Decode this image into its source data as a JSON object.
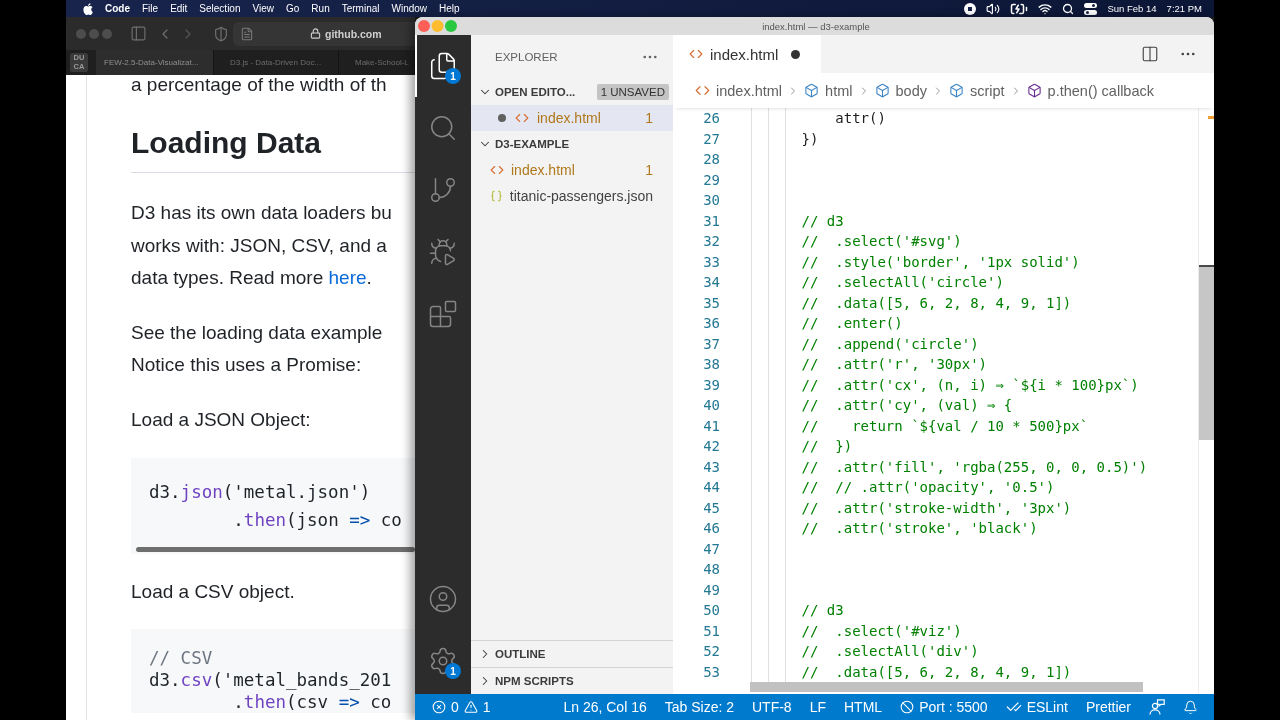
{
  "menu_bar": {
    "app_name": "Code",
    "menus": [
      "File",
      "Edit",
      "Selection",
      "View",
      "Go",
      "Run",
      "Terminal",
      "Window",
      "Help"
    ],
    "date": "Sun Feb 14",
    "time": "7:21 PM"
  },
  "browser": {
    "address": "github.com",
    "pinned_tab": "DU CA",
    "tabs": [
      {
        "label": "FEW-2.5-Data-Visualizat...",
        "selected": true
      },
      {
        "label": "D3.js - Data-Driven Doc...",
        "selected": false
      },
      {
        "label": "Make-School-L",
        "selected": false
      }
    ],
    "page": {
      "cut_line": "a percentage of the width of th",
      "heading": "Loading Data",
      "blocks": [
        {
          "kind": "paragraph",
          "lines": [
            [
              {
                "kind": "text",
                "text": "D3 has its own data loaders bu"
              }
            ],
            [
              {
                "kind": "text",
                "text": "works with: JSON, CSV, and a"
              }
            ],
            [
              {
                "kind": "text",
                "text": "data types. Read more "
              },
              {
                "kind": "link",
                "text": "here"
              },
              {
                "kind": "text",
                "text": "."
              }
            ]
          ]
        },
        {
          "kind": "paragraph",
          "lines": [
            [
              {
                "kind": "text",
                "text": "See the loading data example"
              }
            ],
            [
              {
                "kind": "text",
                "text": "Notice this uses a Promise:"
              }
            ]
          ]
        },
        {
          "kind": "paragraph",
          "lines": [
            [
              {
                "kind": "text",
                "text": "Load a JSON Object:"
              }
            ]
          ]
        },
        {
          "kind": "code",
          "scrollbar": true,
          "lines": [
            [
              {
                "kind": "plain",
                "text": "d3."
              },
              {
                "kind": "method",
                "text": "json"
              },
              {
                "kind": "plain",
                "text": "('metal.json')"
              }
            ],
            [
              {
                "kind": "plain",
                "text": "        ."
              },
              {
                "kind": "method",
                "text": "then"
              },
              {
                "kind": "plain",
                "text": "(json "
              },
              {
                "kind": "operator",
                "text": "=>"
              },
              {
                "kind": "plain",
                "text": " co"
              }
            ]
          ]
        },
        {
          "kind": "paragraph",
          "lines": [
            [
              {
                "kind": "text",
                "text": "Load a CSV object."
              }
            ]
          ]
        },
        {
          "kind": "code",
          "lines": [
            [
              {
                "kind": "comment",
                "text": "// CSV"
              }
            ],
            [
              {
                "kind": "plain",
                "text": "d3."
              },
              {
                "kind": "method",
                "text": "csv"
              },
              {
                "kind": "plain",
                "text": "('metal_bands_201"
              }
            ],
            [
              {
                "kind": "plain",
                "text": "        ."
              },
              {
                "kind": "method",
                "text": "then"
              },
              {
                "kind": "plain",
                "text": "(csv "
              },
              {
                "kind": "operator",
                "text": "=>"
              },
              {
                "kind": "plain",
                "text": " co"
              }
            ]
          ]
        }
      ]
    }
  },
  "editor_window": {
    "title": "index.html — d3-example",
    "activity_bar": [
      {
        "kind": "explorer",
        "selected": true,
        "badge": "1"
      },
      {
        "kind": "search",
        "selected": false
      },
      {
        "kind": "source_control",
        "selected": false
      },
      {
        "kind": "run_debug",
        "selected": false
      },
      {
        "kind": "extensions",
        "selected": false
      }
    ],
    "activity_bar_bottom": [
      {
        "kind": "accounts"
      },
      {
        "kind": "settings",
        "badge": "1"
      }
    ],
    "sidebar": {
      "title": "EXPLORER",
      "sections": [
        {
          "title": "OPEN EDITO...",
          "expanded": true,
          "badge": "1 UNSAVED",
          "items": [
            {
              "kind": "html",
              "name": "index.html",
              "modified": true,
              "problems": "1",
              "selected": true
            }
          ]
        },
        {
          "title": "D3-EXAMPLE",
          "expanded": true,
          "items": [
            {
              "kind": "html",
              "name": "index.html",
              "problems": "1",
              "selected": false
            },
            {
              "kind": "json",
              "name": "titanic-passengers.json",
              "selected": false
            }
          ]
        },
        {
          "title": "OUTLINE",
          "expanded": false
        },
        {
          "title": "NPM SCRIPTS",
          "expanded": false
        }
      ]
    },
    "tabs": [
      {
        "kind": "html",
        "label": "index.html",
        "modified": true,
        "selected": true
      }
    ],
    "breadcrumbs": [
      {
        "kind": "file",
        "label": "index.html"
      },
      {
        "kind": "element",
        "label": "html"
      },
      {
        "kind": "element",
        "label": "body"
      },
      {
        "kind": "element",
        "label": "script"
      },
      {
        "kind": "function",
        "label": "p.then() callback"
      }
    ],
    "code": [
      {
        "number": "26",
        "kind": "code",
        "text": "          attr()"
      },
      {
        "number": "27",
        "kind": "code",
        "text": "      })"
      },
      {
        "number": "28"
      },
      {
        "number": "29"
      },
      {
        "number": "30"
      },
      {
        "number": "31",
        "kind": "comment",
        "text": "      // d3"
      },
      {
        "number": "32",
        "kind": "comment",
        "text": "      //  .select('#svg')"
      },
      {
        "number": "33",
        "kind": "comment",
        "text": "      //  .style('border', '1px solid')"
      },
      {
        "number": "34",
        "kind": "comment",
        "text": "      //  .selectAll('circle')"
      },
      {
        "number": "35",
        "kind": "comment",
        "text": "      //  .data([5, 6, 2, 8, 4, 9, 1])"
      },
      {
        "number": "36",
        "kind": "comment",
        "text": "      //  .enter()"
      },
      {
        "number": "37",
        "kind": "comment",
        "text": "      //  .append('circle')"
      },
      {
        "number": "38",
        "kind": "comment",
        "text": "      //  .attr('r', '30px')"
      },
      {
        "number": "39",
        "kind": "comment",
        "text": "      //  .attr('cx', (n, i) ⇒ `${i * 100}px`)"
      },
      {
        "number": "40",
        "kind": "comment",
        "text": "      //  .attr('cy', (val) ⇒ {"
      },
      {
        "number": "41",
        "kind": "comment",
        "text": "      //    return `${val / 10 * 500}px`"
      },
      {
        "number": "42",
        "kind": "comment",
        "text": "      //  })"
      },
      {
        "number": "43",
        "kind": "comment",
        "text": "      //  .attr('fill', 'rgba(255, 0, 0, 0.5)')"
      },
      {
        "number": "44",
        "kind": "comment",
        "text": "      //  // .attr('opacity', '0.5')"
      },
      {
        "number": "45",
        "kind": "comment",
        "text": "      //  .attr('stroke-width', '3px')"
      },
      {
        "number": "46",
        "kind": "comment",
        "text": "      //  .attr('stroke', 'black')"
      },
      {
        "number": "47"
      },
      {
        "number": "48"
      },
      {
        "number": "49"
      },
      {
        "number": "50",
        "kind": "comment",
        "text": "      // d3"
      },
      {
        "number": "51",
        "kind": "comment",
        "text": "      //  .select('#viz')"
      },
      {
        "number": "52",
        "kind": "comment",
        "text": "      //  .selectAll('div')"
      },
      {
        "number": "53",
        "kind": "comment",
        "text": "      //  .data([5, 6, 2, 8, 4, 9, 1])"
      }
    ],
    "status_bar": {
      "errors": "0",
      "warnings": "1",
      "items": [
        {
          "kind": "text",
          "label": "Ln 26, Col 16"
        },
        {
          "kind": "text",
          "label": "Tab Size: 2"
        },
        {
          "kind": "text",
          "label": "UTF-8"
        },
        {
          "kind": "text",
          "label": "LF"
        },
        {
          "kind": "text",
          "label": "HTML"
        },
        {
          "kind": "port",
          "label": "Port : 5500"
        },
        {
          "kind": "eslint",
          "label": "ESLint"
        },
        {
          "kind": "text",
          "label": "Prettier"
        },
        {
          "kind": "feedback"
        },
        {
          "kind": "notifications"
        }
      ]
    }
  }
}
